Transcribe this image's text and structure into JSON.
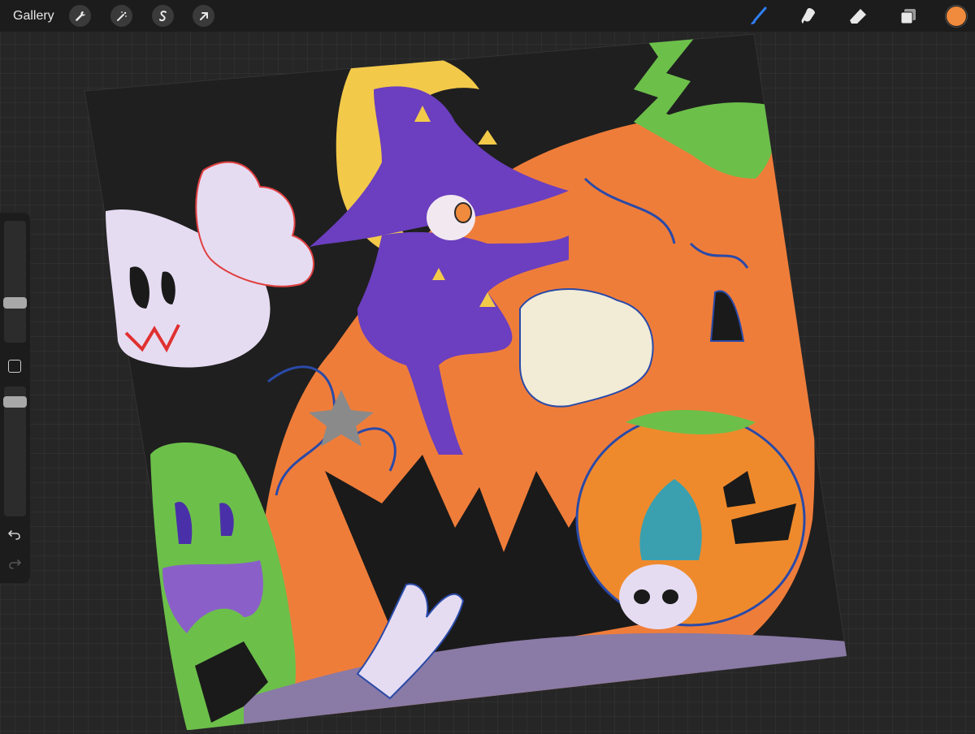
{
  "toolbar": {
    "gallery_label": "Gallery",
    "left_tools": [
      "wrench-icon",
      "magic-wand-icon",
      "selection-icon",
      "transform-arrow-icon"
    ],
    "right_tools": [
      "brush-icon",
      "smudge-icon",
      "eraser-icon",
      "layers-icon"
    ],
    "active_tool": "brush-icon",
    "current_color": "#f08a3c",
    "active_accent": "#2f7ef5"
  },
  "sidebar": {
    "brush_size_slider": {
      "value": 0.32
    },
    "opacity_slider": {
      "value": 0.95
    },
    "icons": [
      "modify-square-icon",
      "undo-icon",
      "redo-icon"
    ]
  },
  "canvas": {
    "description_colors": {
      "background": "#1e1e1e",
      "pumpkin": "#ef7d3a",
      "witch_purple": "#6b3fbf",
      "moon_yellow": "#f3c94a",
      "ghost_lilac": "#e6dcf2",
      "slime_green": "#6cc04a",
      "ground_mauve": "#8a7aa6",
      "ink_blue": "#2a4aa8"
    }
  }
}
